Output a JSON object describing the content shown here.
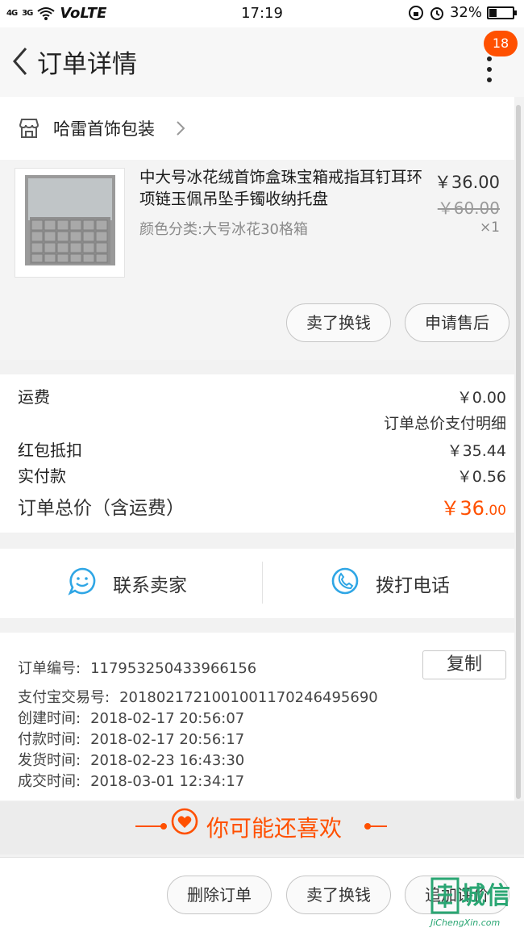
{
  "status_bar": {
    "signal_1": "4G",
    "signal_2": "3G",
    "network": "VoLTE",
    "time": "17:19",
    "battery": "32%"
  },
  "nav": {
    "title": "订单详情",
    "badge": "18"
  },
  "shop": {
    "name": "哈雷首饰包装"
  },
  "product": {
    "title": "中大号冰花绒首饰盒珠宝箱戒指耳钉耳环项链玉佩吊坠手镯收纳托盘",
    "sku": "颜色分类:大号冰花30格箱",
    "price": "￥36.00",
    "original_price": "￥60.00",
    "quantity": "×1",
    "sell_button": "卖了换钱",
    "aftersale_button": "申请售后"
  },
  "cost": {
    "shipping_label": "运费",
    "shipping_value": "￥0.00",
    "detail_link": "订单总价支付明细",
    "redpacket_label": "红包抵扣",
    "redpacket_value": "￥35.44",
    "paid_label": "实付款",
    "paid_value": "￥0.56",
    "total_label": "订单总价（含运费）",
    "total_value_main": "￥36",
    "total_value_cents": ".00"
  },
  "contact": {
    "seller_label": "联系卖家",
    "call_label": "拨打电话"
  },
  "order_info": {
    "copy_button": "复制",
    "rows": [
      {
        "key": "订单编号:",
        "value": "117953250433966156"
      },
      {
        "key": "支付宝交易号:",
        "value": "2018021721001001170246495690"
      },
      {
        "key": "创建时间:",
        "value": "2018-02-17 20:56:07"
      },
      {
        "key": "付款时间:",
        "value": "2018-02-17 20:56:17"
      },
      {
        "key": "发货时间:",
        "value": "2018-02-23 16:43:30"
      },
      {
        "key": "成交时间:",
        "value": "2018-03-01 12:34:17"
      }
    ]
  },
  "recommend": {
    "title": "你可能还喜欢"
  },
  "bottom": {
    "delete_button": "删除订单",
    "sell_button": "卖了换钱",
    "review_button": "追加评价"
  },
  "watermark": {
    "title": "城信",
    "url": "JiChengXin.com"
  },
  "colors": {
    "accent": "#ff5000",
    "link_blue": "#2fa6e5"
  }
}
